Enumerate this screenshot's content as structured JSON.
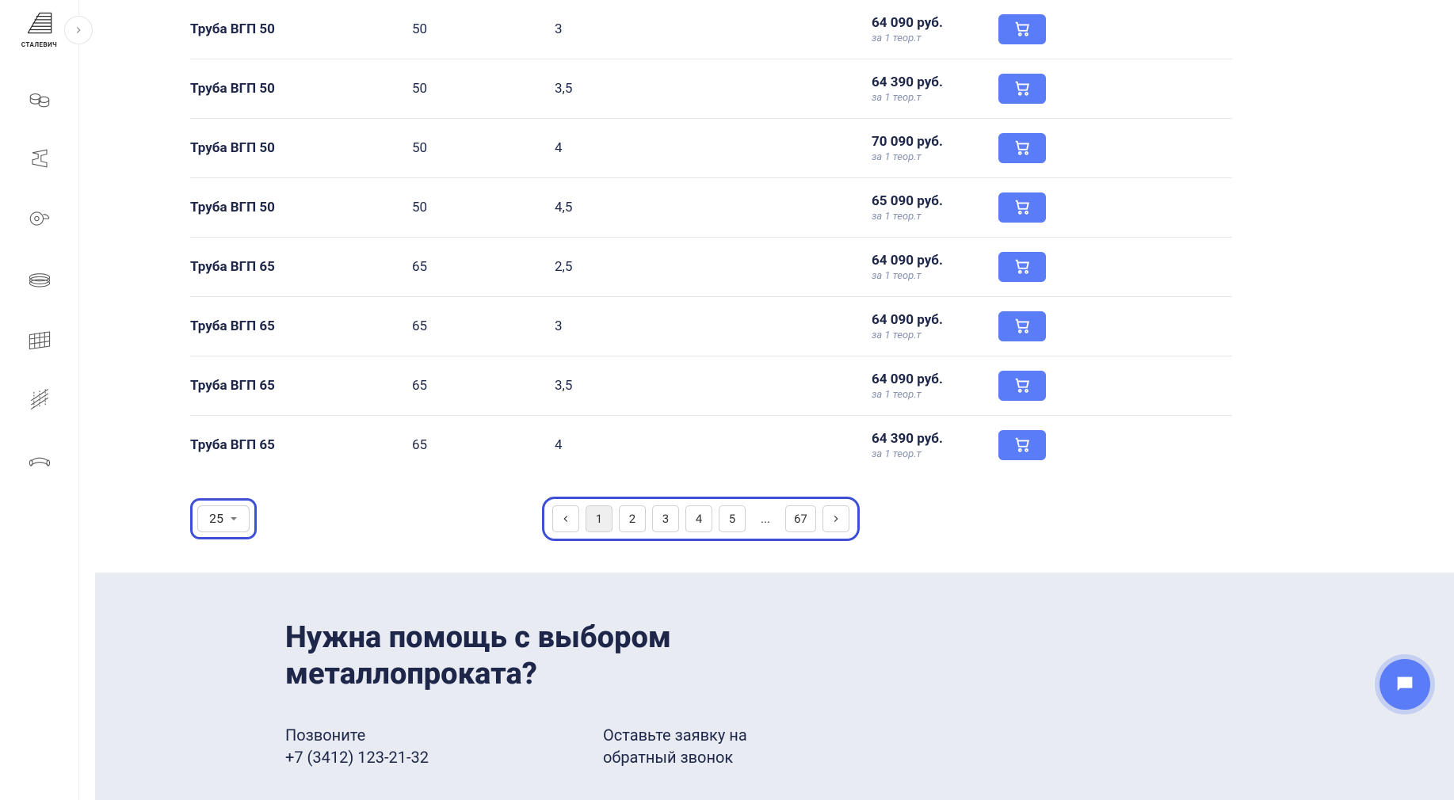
{
  "brand": "СТАЛЕВИЧ",
  "sidebar_icons": [
    "pipes-icon",
    "beam-icon",
    "coil-icon",
    "wire-ring-icon",
    "mesh-icon",
    "rebar-icon",
    "fittings-icon"
  ],
  "rows": [
    {
      "name": "Труба ВГП 50",
      "dim": "50",
      "thick": "3",
      "price": "64 090 руб.",
      "unit": "за 1 теор.т"
    },
    {
      "name": "Труба ВГП 50",
      "dim": "50",
      "thick": "3,5",
      "price": "64 390 руб.",
      "unit": "за 1 теор.т"
    },
    {
      "name": "Труба ВГП 50",
      "dim": "50",
      "thick": "4",
      "price": "70 090 руб.",
      "unit": "за 1 теор.т"
    },
    {
      "name": "Труба ВГП 50",
      "dim": "50",
      "thick": "4,5",
      "price": "65 090 руб.",
      "unit": "за 1 теор.т"
    },
    {
      "name": "Труба ВГП 65",
      "dim": "65",
      "thick": "2,5",
      "price": "64 090 руб.",
      "unit": "за 1 теор.т"
    },
    {
      "name": "Труба ВГП 65",
      "dim": "65",
      "thick": "3",
      "price": "64 090 руб.",
      "unit": "за 1 теор.т"
    },
    {
      "name": "Труба ВГП 65",
      "dim": "65",
      "thick": "3,5",
      "price": "64 090 руб.",
      "unit": "за 1 теор.т"
    },
    {
      "name": "Труба ВГП 65",
      "dim": "65",
      "thick": "4",
      "price": "64 390 руб.",
      "unit": "за 1 теор.т"
    }
  ],
  "per_page": {
    "value": "25"
  },
  "pagination": {
    "pages": [
      "1",
      "2",
      "3",
      "4",
      "5",
      "...",
      "67"
    ],
    "active": "1"
  },
  "footer": {
    "title": "Нужна помощь с выбором металлопроката?",
    "call_label": "Позвоните",
    "phone": "+7 (3412) 123-21-32",
    "callback_line1": "Оставьте заявку на",
    "callback_line2": "обратный звонок"
  }
}
